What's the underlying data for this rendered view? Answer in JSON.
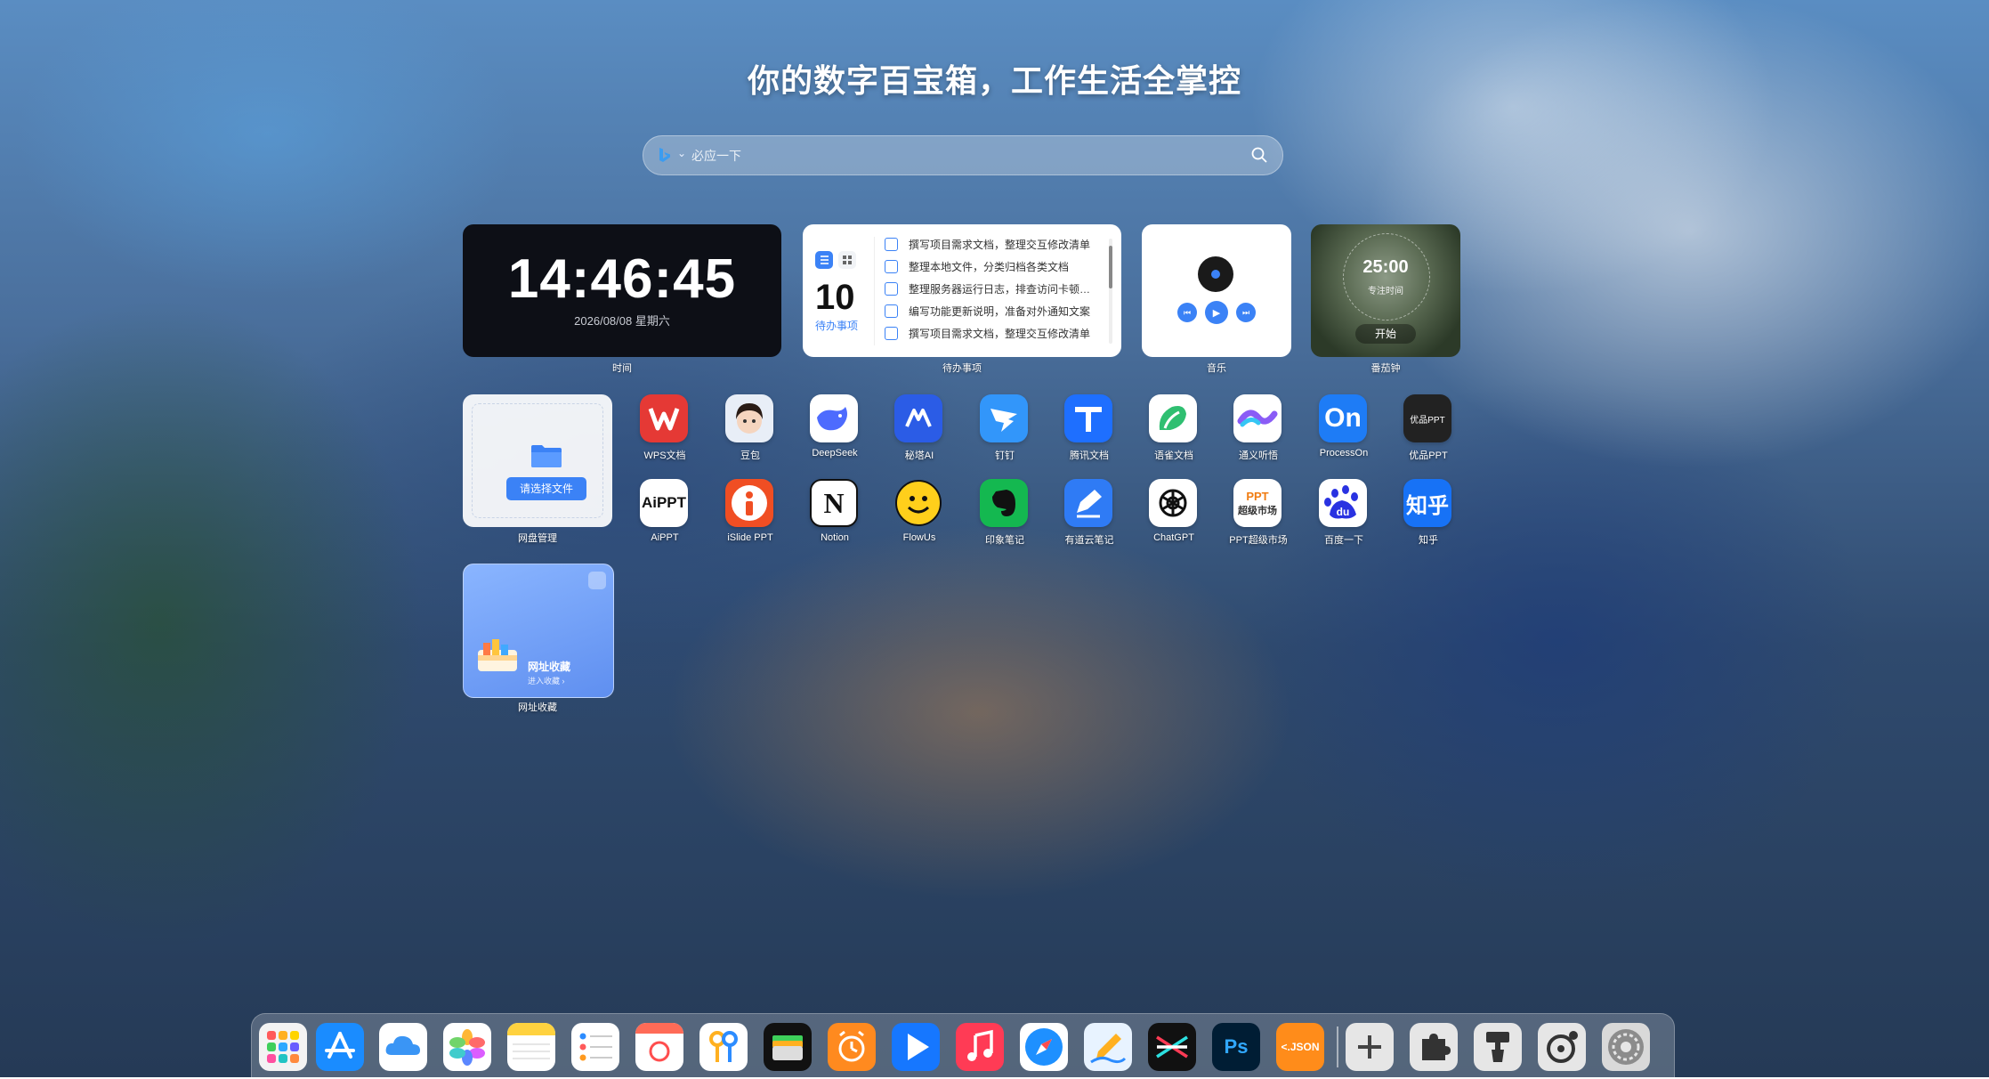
{
  "page": {
    "title": "你的数字百宝箱，工作生活全掌控"
  },
  "search": {
    "placeholder": "必应一下"
  },
  "widgets": {
    "clock": {
      "time": "14:46:45",
      "date": "2026/08/08 星期六",
      "label": "时间"
    },
    "todo": {
      "count": "10",
      "count_label": "待办事项",
      "label": "待办事项",
      "items": [
        "撰写项目需求文档，整理交互修改清单",
        "整理本地文件，分类归档各类文档",
        "整理服务器运行日志，排查访问卡顿…",
        "编写功能更新说明，准备对外通知文案",
        "撰写项目需求文档，整理交互修改清单"
      ]
    },
    "music": {
      "label": "音乐"
    },
    "pomodoro": {
      "time": "25:00",
      "subtitle": "专注时间",
      "start": "开始",
      "label": "番茄钟"
    },
    "netdisk": {
      "button": "请选择文件",
      "label": "网盘管理"
    },
    "favorites": {
      "title": "网址收藏",
      "subtitle": "进入收藏 ›",
      "label": "网址收藏"
    }
  },
  "apps": [
    {
      "label": "WPS文档",
      "icon": "wps-icon"
    },
    {
      "label": "豆包",
      "icon": "doubao-icon"
    },
    {
      "label": "DeepSeek",
      "icon": "deepseek-icon"
    },
    {
      "label": "秘塔AI",
      "icon": "metaso-icon"
    },
    {
      "label": "钉钉",
      "icon": "dingtalk-icon"
    },
    {
      "label": "腾讯文档",
      "icon": "tencent-docs-icon"
    },
    {
      "label": "语雀文档",
      "icon": "yuque-icon"
    },
    {
      "label": "通义听悟",
      "icon": "tingwu-icon"
    },
    {
      "label": "ProcessOn",
      "icon": "processon-icon",
      "text": "On"
    },
    {
      "label": "优品PPT",
      "icon": "youpin-ppt-icon",
      "text": "优品PPT"
    },
    {
      "label": "AiPPT",
      "icon": "aippt-icon",
      "text": "AiPPT"
    },
    {
      "label": "iSlide PPT",
      "icon": "islide-icon"
    },
    {
      "label": "Notion",
      "icon": "notion-icon",
      "text": "N"
    },
    {
      "label": "FlowUs",
      "icon": "flowus-icon"
    },
    {
      "label": "印象笔记",
      "icon": "evernote-icon"
    },
    {
      "label": "有道云笔记",
      "icon": "youdao-note-icon"
    },
    {
      "label": "ChatGPT",
      "icon": "chatgpt-icon"
    },
    {
      "label": "PPT超级市场",
      "icon": "ppt-market-icon",
      "text": "PPT",
      "text2": "超级市场"
    },
    {
      "label": "百度一下",
      "icon": "baidu-icon",
      "text": "du"
    },
    {
      "label": "知乎",
      "icon": "zhihu-icon",
      "text": "知乎"
    }
  ],
  "dock": {
    "items": [
      {
        "icon": "launchpad-icon"
      },
      {
        "icon": "app-store-icon"
      },
      {
        "icon": "icloud-icon"
      },
      {
        "icon": "photos-icon"
      },
      {
        "icon": "notes-icon"
      },
      {
        "icon": "reminders-icon"
      },
      {
        "icon": "calendar-icon"
      },
      {
        "icon": "keys-icon"
      },
      {
        "icon": "wallet-icon"
      },
      {
        "icon": "alarm-icon"
      },
      {
        "icon": "video-player-icon"
      },
      {
        "icon": "music-icon"
      },
      {
        "icon": "safari-icon"
      },
      {
        "icon": "freeform-icon"
      },
      {
        "icon": "capcut-icon"
      },
      {
        "icon": "photoshop-icon",
        "text": "Ps"
      },
      {
        "icon": "json-icon",
        "text": "<.JSON"
      },
      {
        "icon": "add-icon"
      },
      {
        "icon": "plugin-icon"
      },
      {
        "icon": "theme-brush-icon"
      },
      {
        "icon": "settings-clock-icon"
      },
      {
        "icon": "system-settings-icon"
      }
    ]
  },
  "colors": {
    "accent": "#3b82f6",
    "clock_bg": "#0d0f16"
  }
}
